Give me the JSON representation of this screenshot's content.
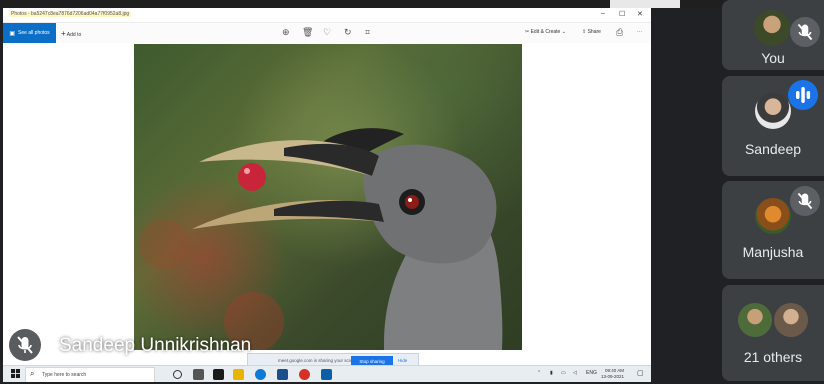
{
  "shared_screen": {
    "window": {
      "title": "Photos - ba5247c8ea7876d7206ad04a77f0952a8.jpg",
      "controls": [
        "–",
        "☐",
        "✕"
      ]
    },
    "toolbar": {
      "see_all_label": "See all photos",
      "add_to_label": "Add to",
      "edit_create_label": "Edit & Create",
      "share_label": "Share",
      "more_label": "···",
      "icons": [
        "zoom-icon",
        "delete-icon",
        "favorite-icon",
        "rotate-icon",
        "crop-icon",
        "print-icon"
      ]
    },
    "sharing_notice": {
      "message": "meet.google.com is sharing your screen.",
      "stop_label": "Stop sharing",
      "hide_label": "Hide"
    },
    "taskbar": {
      "search_placeholder": "Type here to search",
      "tray_lang": "ENG",
      "time": "09:40 AM",
      "date": "13-09-2021"
    }
  },
  "presenter": {
    "name": "Sandeep Unnikrishnan",
    "mic_state": "muted"
  },
  "participants": [
    {
      "name": "You",
      "mic_state": "muted"
    },
    {
      "name": "Sandeep",
      "mic_state": "speaking"
    },
    {
      "name": "Manjusha",
      "mic_state": "muted"
    },
    {
      "name": "21 others",
      "mic_state": "none"
    }
  ],
  "colors": {
    "meet_background": "#202124",
    "tile_background": "#3c4043",
    "speaking_accent": "#1a73e8",
    "photos_accent": "#0b6fc7"
  }
}
